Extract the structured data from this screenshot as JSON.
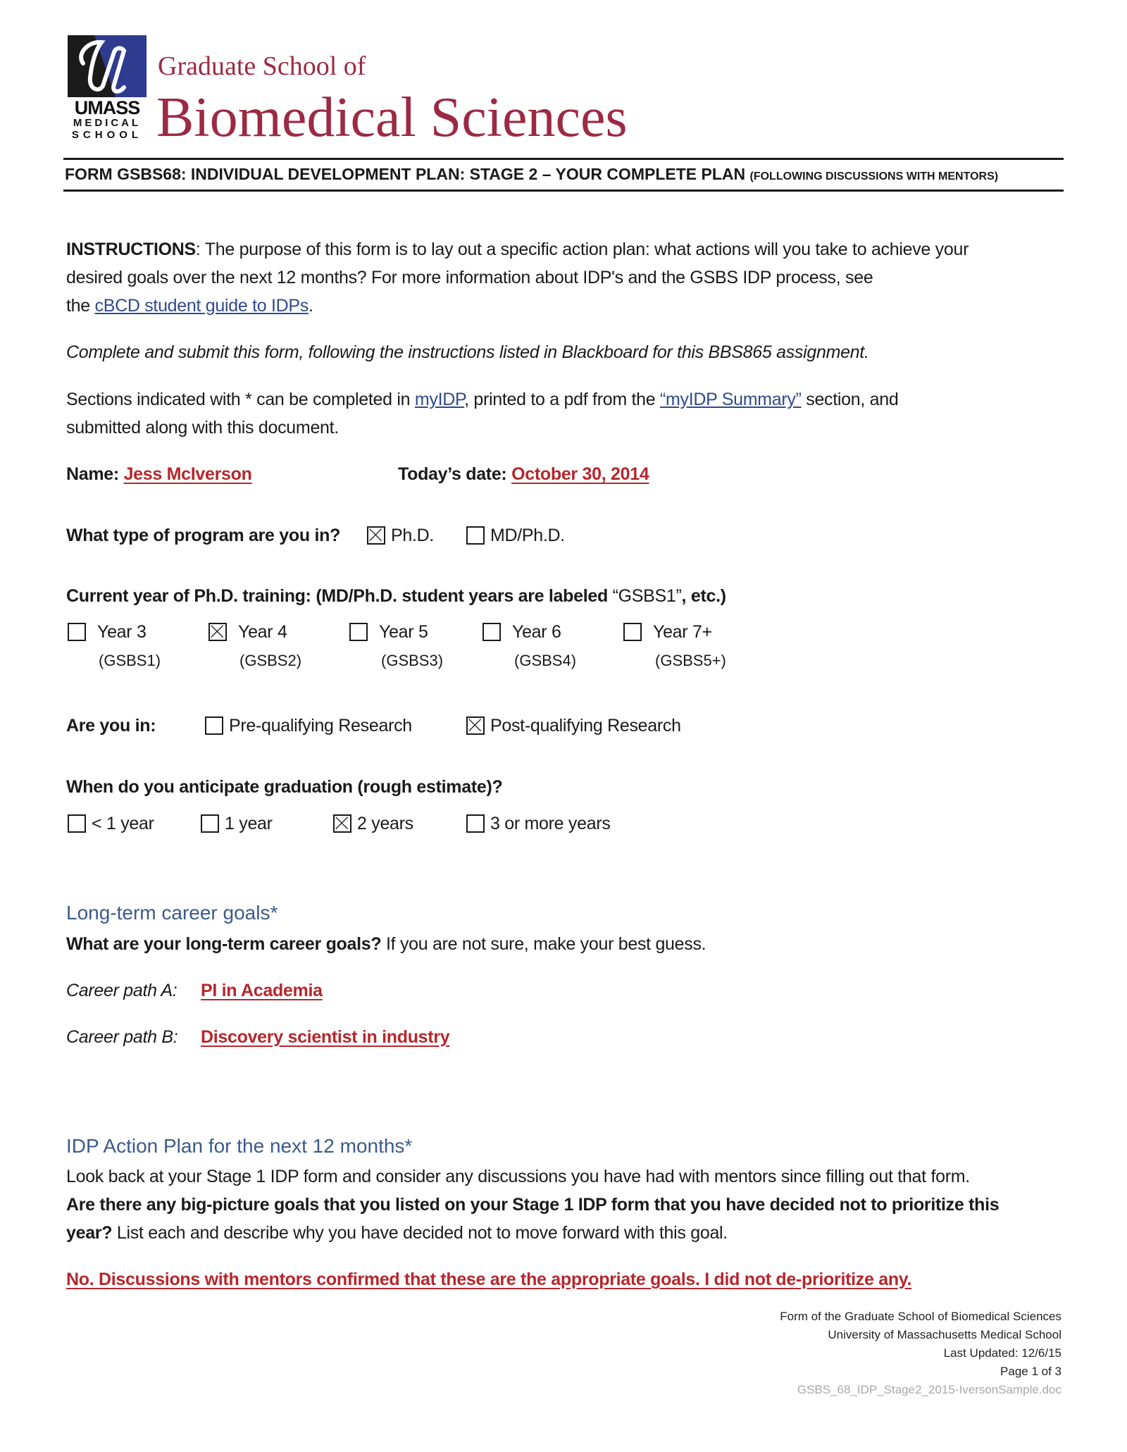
{
  "logo": {
    "icon": "umass-u-logo",
    "line1": "UMASS",
    "line2": "MEDICAL",
    "line3": "SCHOOL"
  },
  "brand": {
    "line1": "Graduate School of",
    "line2": "Biomedical Sciences",
    "color": "#9c2a45"
  },
  "form_header": {
    "title": "FORM GSBS68:  INDIVIDUAL DEVELOPMENT PLAN:  STAGE 2 – YOUR COMPLETE PLAN",
    "subtitle": "(FOLLOWING DISCUSSIONS WITH MENTORS)"
  },
  "instructions": {
    "label": "INSTRUCTIONS",
    "text_line1": ":  The purpose of this form is to lay out a specific action plan: what actions will you take to achieve your",
    "text_line2": "desired goals over the next 12 months? For more information about IDP's and the GSBS IDP process, see",
    "text_line3_prefix": "the ",
    "guide_link": "cBCD student guide to IDPs",
    "text_line3_suffix": "."
  },
  "submit_note": "Complete and submit this form, following the instructions listed in Blackboard for this BBS865 assignment.",
  "sections_note": {
    "prefix": "Sections indicated with * can be completed in ",
    "myidp_link": "myIDP",
    "middle": ", printed to a pdf from the ",
    "summary_link": "“myIDP Summary”",
    "suffix": " section, and",
    "line2": "submitted along with this document."
  },
  "name_field": {
    "label": "Name: ",
    "value": "Jess McIverson"
  },
  "date_field": {
    "label": "Today’s date: ",
    "value": "October 30, 2014"
  },
  "program": {
    "question": "What type of program are you in?",
    "options": [
      {
        "label": "Ph.D.",
        "checked": true
      },
      {
        "label": "MD/Ph.D.",
        "checked": false
      }
    ]
  },
  "current_year": {
    "question_bold": "Current year of Ph.D. training: (MD/Ph.D. student years are labeled ",
    "question_normal": "“GSBS1”",
    "question_end": ", etc.)",
    "options": [
      {
        "label": "Year 3",
        "sub": "(GSBS1)",
        "checked": false
      },
      {
        "label": "Year 4",
        "sub": "(GSBS2)",
        "checked": true
      },
      {
        "label": "Year 5",
        "sub": "(GSBS3)",
        "checked": false
      },
      {
        "label": "Year 6",
        "sub": "(GSBS4)",
        "checked": false
      },
      {
        "label": "Year 7+",
        "sub": "(GSBS5+)",
        "checked": false
      }
    ]
  },
  "research_phase": {
    "question": "Are you in:",
    "options": [
      {
        "label": "Pre-qualifying Research",
        "checked": false
      },
      {
        "label": "Post-qualifying Research",
        "checked": true
      }
    ]
  },
  "graduation": {
    "question": "When do you anticipate graduation (rough estimate)?",
    "options": [
      {
        "label": "< 1 year",
        "checked": false
      },
      {
        "label": "1 year",
        "checked": false
      },
      {
        "label": "2 years",
        "checked": true
      },
      {
        "label": "3 or more years",
        "checked": false
      }
    ]
  },
  "career_goals": {
    "heading": "Long-term career goals*",
    "question_bold": "What are your long-term career goals?",
    "question_normal": "  If you are not sure, make your best guess.",
    "path_a_label": "Career path A:",
    "path_a_value": "PI in Academia",
    "path_b_label": "Career path B:",
    "path_b_value": "Discovery scientist in industry"
  },
  "action_plan": {
    "heading": "IDP Action Plan for the next 12 months*",
    "line1": "Look back at your Stage 1 IDP form and consider any discussions you have had with mentors since filling out that form.",
    "line2_bold": "Are there any big-picture goals that you listed on your Stage 1 IDP form that you have decided not to prioritize this",
    "line3_bold": "year?",
    "line3_normal": "  List each and describe why you have decided not to move forward with this goal.",
    "answer": "No. Discussions with mentors confirmed that these are the appropriate goals. I did not de-prioritize any."
  },
  "footer": {
    "line1": "Form of the Graduate School of Biomedical Sciences",
    "line2": "University of Massachusetts Medical School",
    "line3": "Last Updated: 12/6/15",
    "page": "Page 1 of 3",
    "filename": "GSBS_68_IDP_Stage2_2015-IversonSample.doc"
  },
  "colors": {
    "answer_red": "#b5272d",
    "link_blue": "#2f4a8c",
    "section_blue": "#3b5a8a"
  }
}
